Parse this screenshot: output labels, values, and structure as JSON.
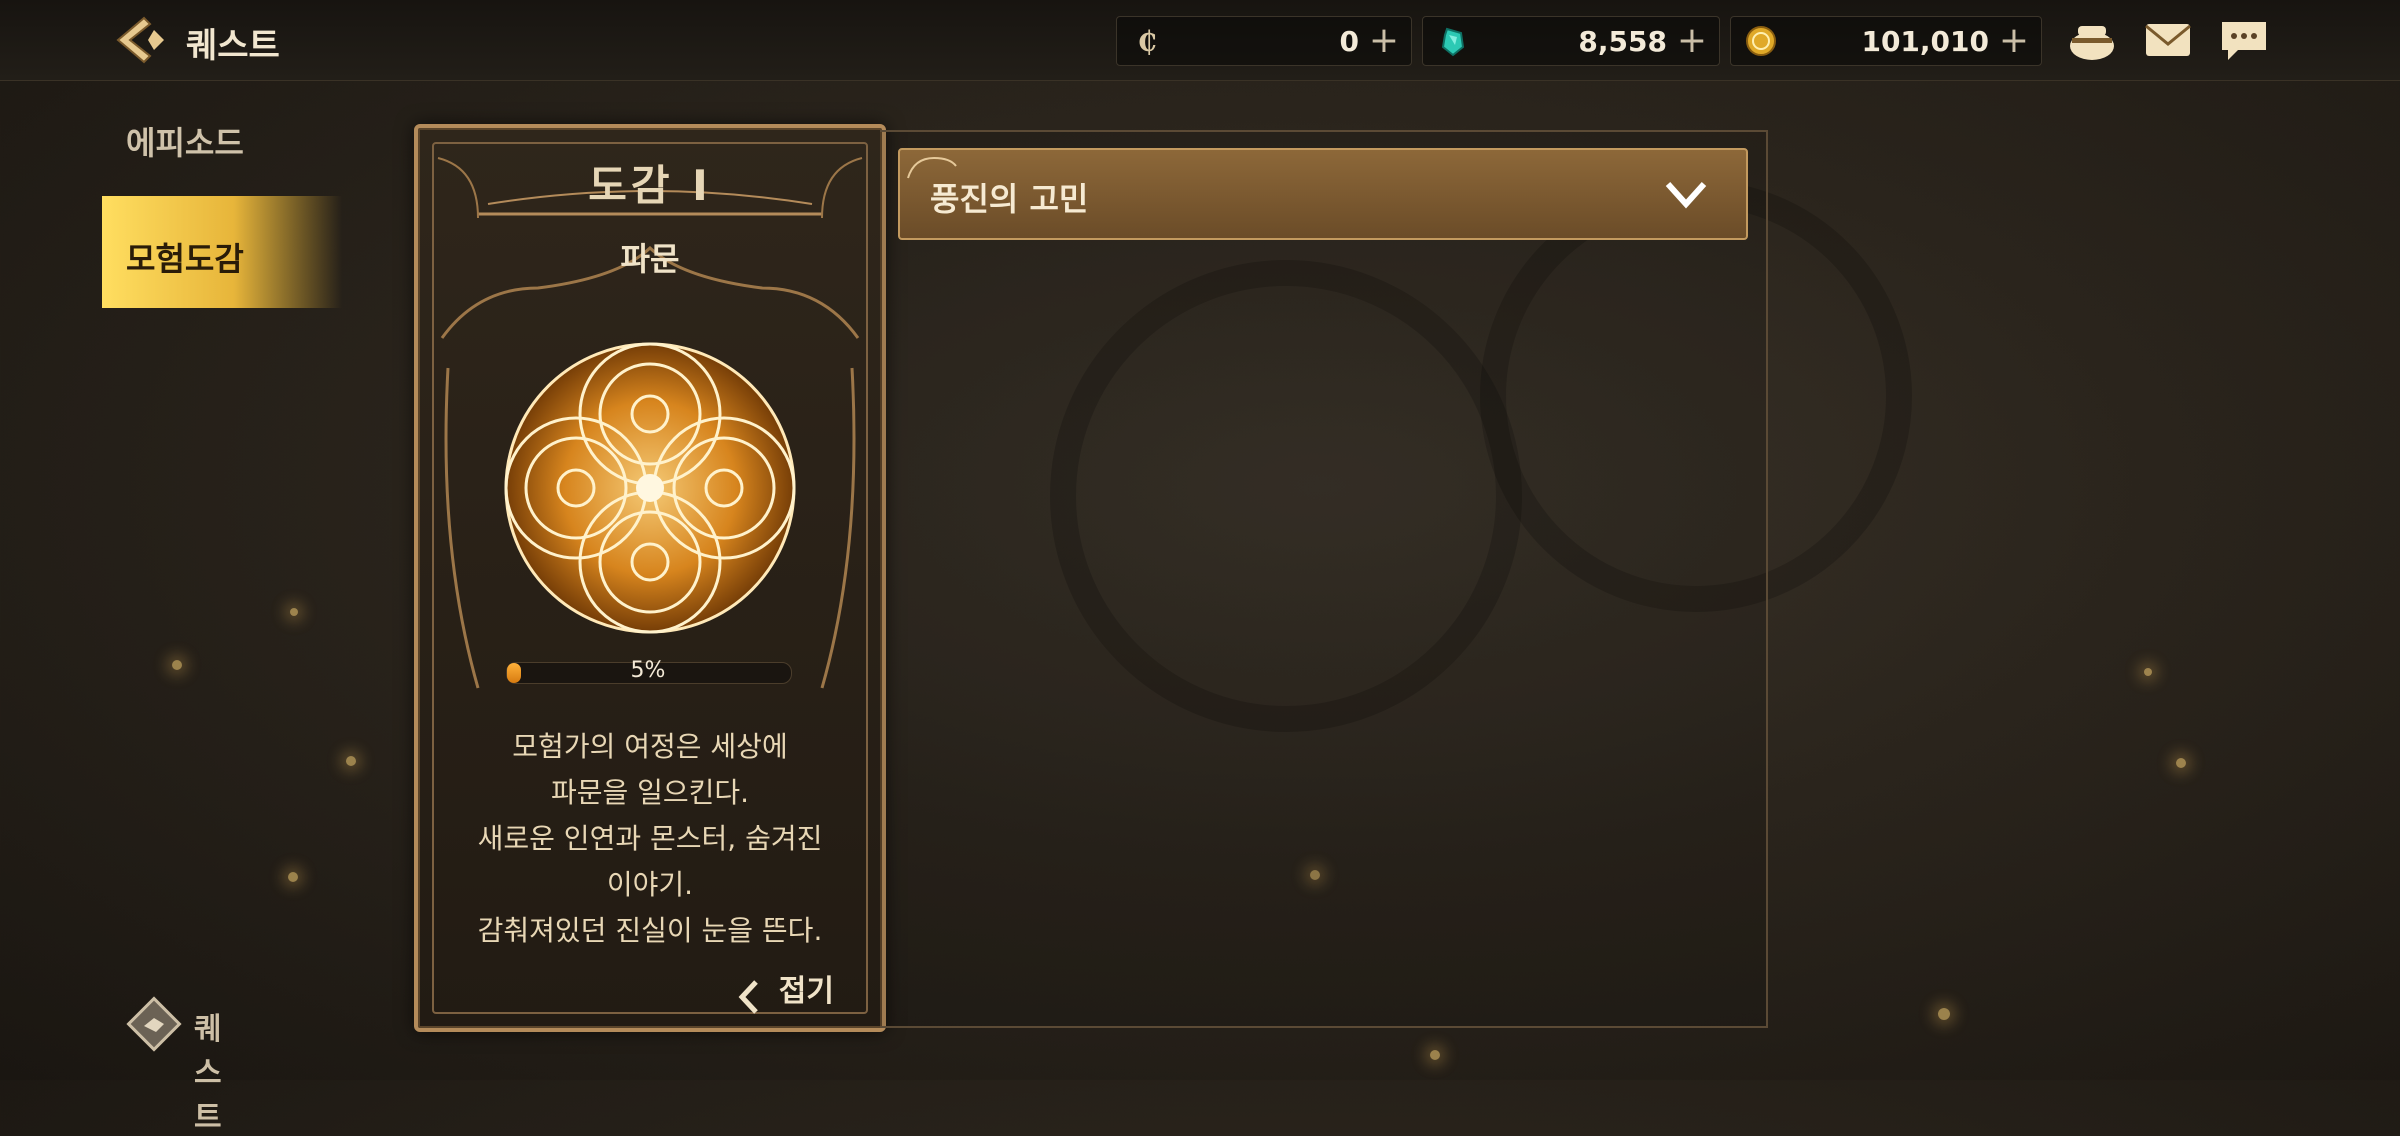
{
  "header": {
    "title": "퀘스트",
    "currencies": [
      {
        "icon": "coin-c-icon",
        "value": "0"
      },
      {
        "icon": "gem-icon",
        "value": "8,558"
      },
      {
        "icon": "gold-coin-icon",
        "value": "101,010"
      }
    ],
    "plus_label": "+",
    "icons": [
      "pouch-icon",
      "mail-icon",
      "chat-icon"
    ]
  },
  "sidebar": {
    "items": [
      {
        "label": "에피소드",
        "active": false
      },
      {
        "label": "모험도감",
        "active": true
      }
    ]
  },
  "card": {
    "title": "도감 Ⅰ",
    "subtitle": "파문",
    "progress_text": "5%",
    "progress_value": 0.05,
    "description": [
      "모험가의 여정은 세상에",
      "파문을 일으킨다.",
      "새로운 인연과 몬스터, 숨겨진",
      "이야기.",
      "감춰져있던 진실이 눈을 뜬다."
    ],
    "collapse_label": "접기"
  },
  "panel": {
    "dropdown_label": "풍진의 고민"
  },
  "footer": {
    "quest_label": "퀘스트"
  },
  "colors": {
    "accent_gold": "#e7b53a",
    "progress": "#ffb13a",
    "frame": "#b48b5a"
  }
}
